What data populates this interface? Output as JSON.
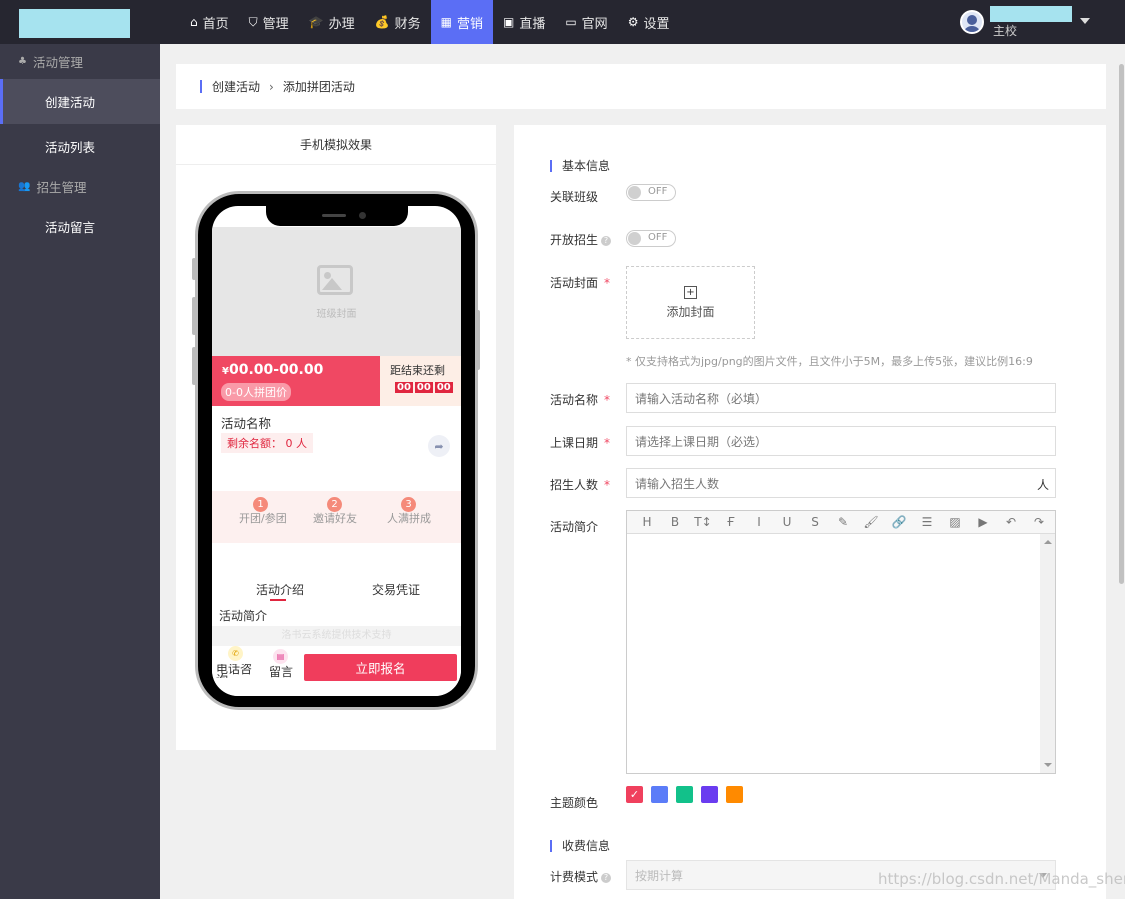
{
  "nav": {
    "items": [
      {
        "icon": "home-icon",
        "glyph": "⌂",
        "label": "首页",
        "active": false
      },
      {
        "icon": "shield-icon",
        "glyph": "⛉",
        "label": "管理",
        "active": false
      },
      {
        "icon": "graduation-cap-icon",
        "glyph": "🎓",
        "label": "办理",
        "active": false
      },
      {
        "icon": "money-bag-icon",
        "glyph": "💰",
        "label": "财务",
        "active": false
      },
      {
        "icon": "grid-icon",
        "glyph": "▦",
        "label": "营销",
        "active": true
      },
      {
        "icon": "tv-icon",
        "glyph": "▣",
        "label": "直播",
        "active": false
      },
      {
        "icon": "window-icon",
        "glyph": "▭",
        "label": "官网",
        "active": false
      },
      {
        "icon": "gear-icon",
        "glyph": "⚙",
        "label": "设置",
        "active": false
      }
    ]
  },
  "user": {
    "role": "主校"
  },
  "sidebar": {
    "groups": [
      {
        "label": "活动管理",
        "items": [
          "创建活动",
          "活动列表"
        ]
      },
      {
        "label": "招生管理",
        "items": [
          "活动留言"
        ]
      }
    ],
    "active": "创建活动"
  },
  "breadcrumb": {
    "parent": "创建活动",
    "current": "添加拼团活动"
  },
  "preview": {
    "title": "手机模拟效果",
    "cover_text": "班级封面",
    "price": "00.00-00.00",
    "currency": "¥",
    "group_tag": "0-0人拼团价",
    "countdown_label": "距结束还剩",
    "countdown": [
      "00",
      "00",
      "00"
    ],
    "activity_name": "活动名称",
    "remain": "剩余名额：  0 人",
    "steps": [
      "开团/参团",
      "邀请好友",
      "人满拼成"
    ],
    "step_nums": [
      "1",
      "2",
      "3"
    ],
    "tabs": [
      "活动介绍",
      "交易凭证"
    ],
    "intro": "活动简介",
    "grey_text": "洛书云系统提供技术支持",
    "phone_label": "电话咨询",
    "message_label": "留言",
    "signup": "立即报名"
  },
  "form": {
    "basic_section": "基本信息",
    "link_class": "关联班级",
    "open_enroll": "开放招生",
    "toggle_off": "OFF",
    "cover_label": "活动封面",
    "add_cover": "添加封面",
    "cover_hint": "* 仅支持格式为jpg/png的图片文件，且文件小于5M，最多上传5张，建议比例16:9",
    "name_label": "活动名称",
    "name_placeholder": "请输入活动名称（必填）",
    "date_label": "上课日期",
    "date_placeholder": "请选择上课日期（必选）",
    "count_label": "招生人数",
    "count_placeholder": "请输入招生人数",
    "count_suffix": "人",
    "desc_label": "活动简介",
    "theme_label": "主题颜色",
    "theme_colors": [
      "#f0405d",
      "#5b7cf8",
      "#12c18a",
      "#6a3cf0",
      "#ff8a00"
    ],
    "fee_section": "收费信息",
    "fee_mode_label": "计费模式",
    "fee_mode_value": "按期计算"
  },
  "editor_tools": [
    "H",
    "B",
    "T↕",
    "Ғ",
    "I",
    "U",
    "S",
    "✎",
    "🖌",
    "🔗",
    "☰",
    "▨",
    "▶",
    "↶",
    "↷"
  ],
  "watermark": "https://blog.csdn.net/Manda_shen"
}
